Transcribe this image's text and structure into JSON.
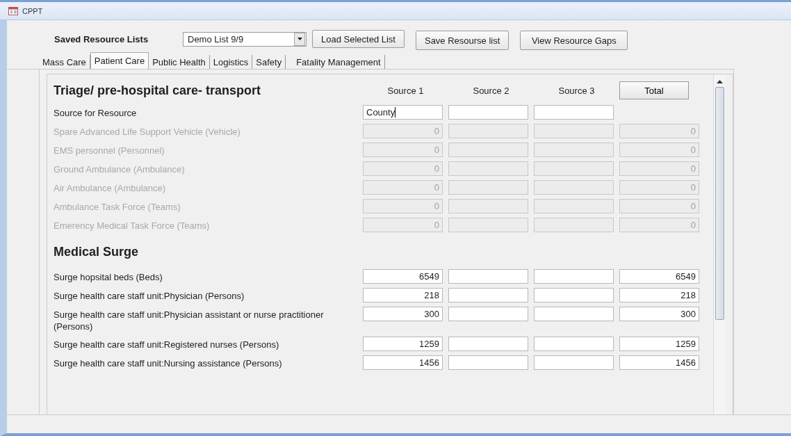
{
  "window": {
    "title": "CPPT"
  },
  "toolbar": {
    "label": "Saved Resource Lists",
    "dropdown": {
      "value": "Demo List 9/9"
    },
    "buttons": [
      "Load Selected List",
      "Save Resourse list",
      "View Resource Gaps"
    ]
  },
  "tabs": [
    {
      "label": "Mass Care",
      "selected": false
    },
    {
      "label": "Patient Care",
      "selected": true
    },
    {
      "label": "Public Health",
      "selected": false
    },
    {
      "label": "Logistics",
      "selected": false
    },
    {
      "label": "Safety",
      "selected": false
    },
    {
      "label": "Fatality Management",
      "selected": false
    }
  ],
  "columns": [
    "Source 1",
    "Source 2",
    "Source 3"
  ],
  "total_button": "Total",
  "sections": [
    {
      "heading": "Triage/ pre-hospital care- transport",
      "source_row": {
        "label": "Source for Resource",
        "fields": [
          {
            "value": "County",
            "focused": true
          },
          {
            "focused": false
          },
          {
            "focused": false
          }
        ]
      },
      "rows": [
        {
          "label": "Spare Advanced Life Support Vehicle (Vehicle)",
          "disabled": true,
          "source_1": "0",
          "total": "0"
        },
        {
          "label": "EMS personnel (Personnel)",
          "disabled": true,
          "source_1": "0",
          "total": "0"
        },
        {
          "label": "Ground Ambulance (Ambulance)",
          "disabled": true,
          "source_1": "0",
          "total": "0"
        },
        {
          "label": "Air Ambulance (Ambulance)",
          "disabled": true,
          "source_1": "0",
          "total": "0"
        },
        {
          "label": "Ambulance Task Force (Teams)",
          "disabled": true,
          "source_1": "0",
          "total": "0"
        },
        {
          "label": "Emerency Medical Task Force (Teams)",
          "disabled": true,
          "source_1": "0",
          "total": "0"
        }
      ]
    },
    {
      "heading": "Medical Surge",
      "rows": [
        {
          "label": "Surge hopsital beds (Beds)",
          "disabled": false,
          "source_1": "6549",
          "total": "6549"
        },
        {
          "label": "Surge health care staff unit:Physician (Persons)",
          "disabled": false,
          "source_1": "218",
          "total": "218"
        },
        {
          "label": "Surge health care staff unit:Physician assistant or nurse practitioner (Persons)",
          "disabled": false,
          "source_1": "300",
          "total": "300"
        },
        {
          "label": "Surge health care staff unit:Registered nurses (Persons)",
          "disabled": false,
          "source_1": "1259",
          "total": "1259"
        },
        {
          "label": "Surge health care staff unit:Nursing assistance (Persons)",
          "disabled": false,
          "source_1": "1456",
          "total": "1456"
        }
      ]
    }
  ]
}
